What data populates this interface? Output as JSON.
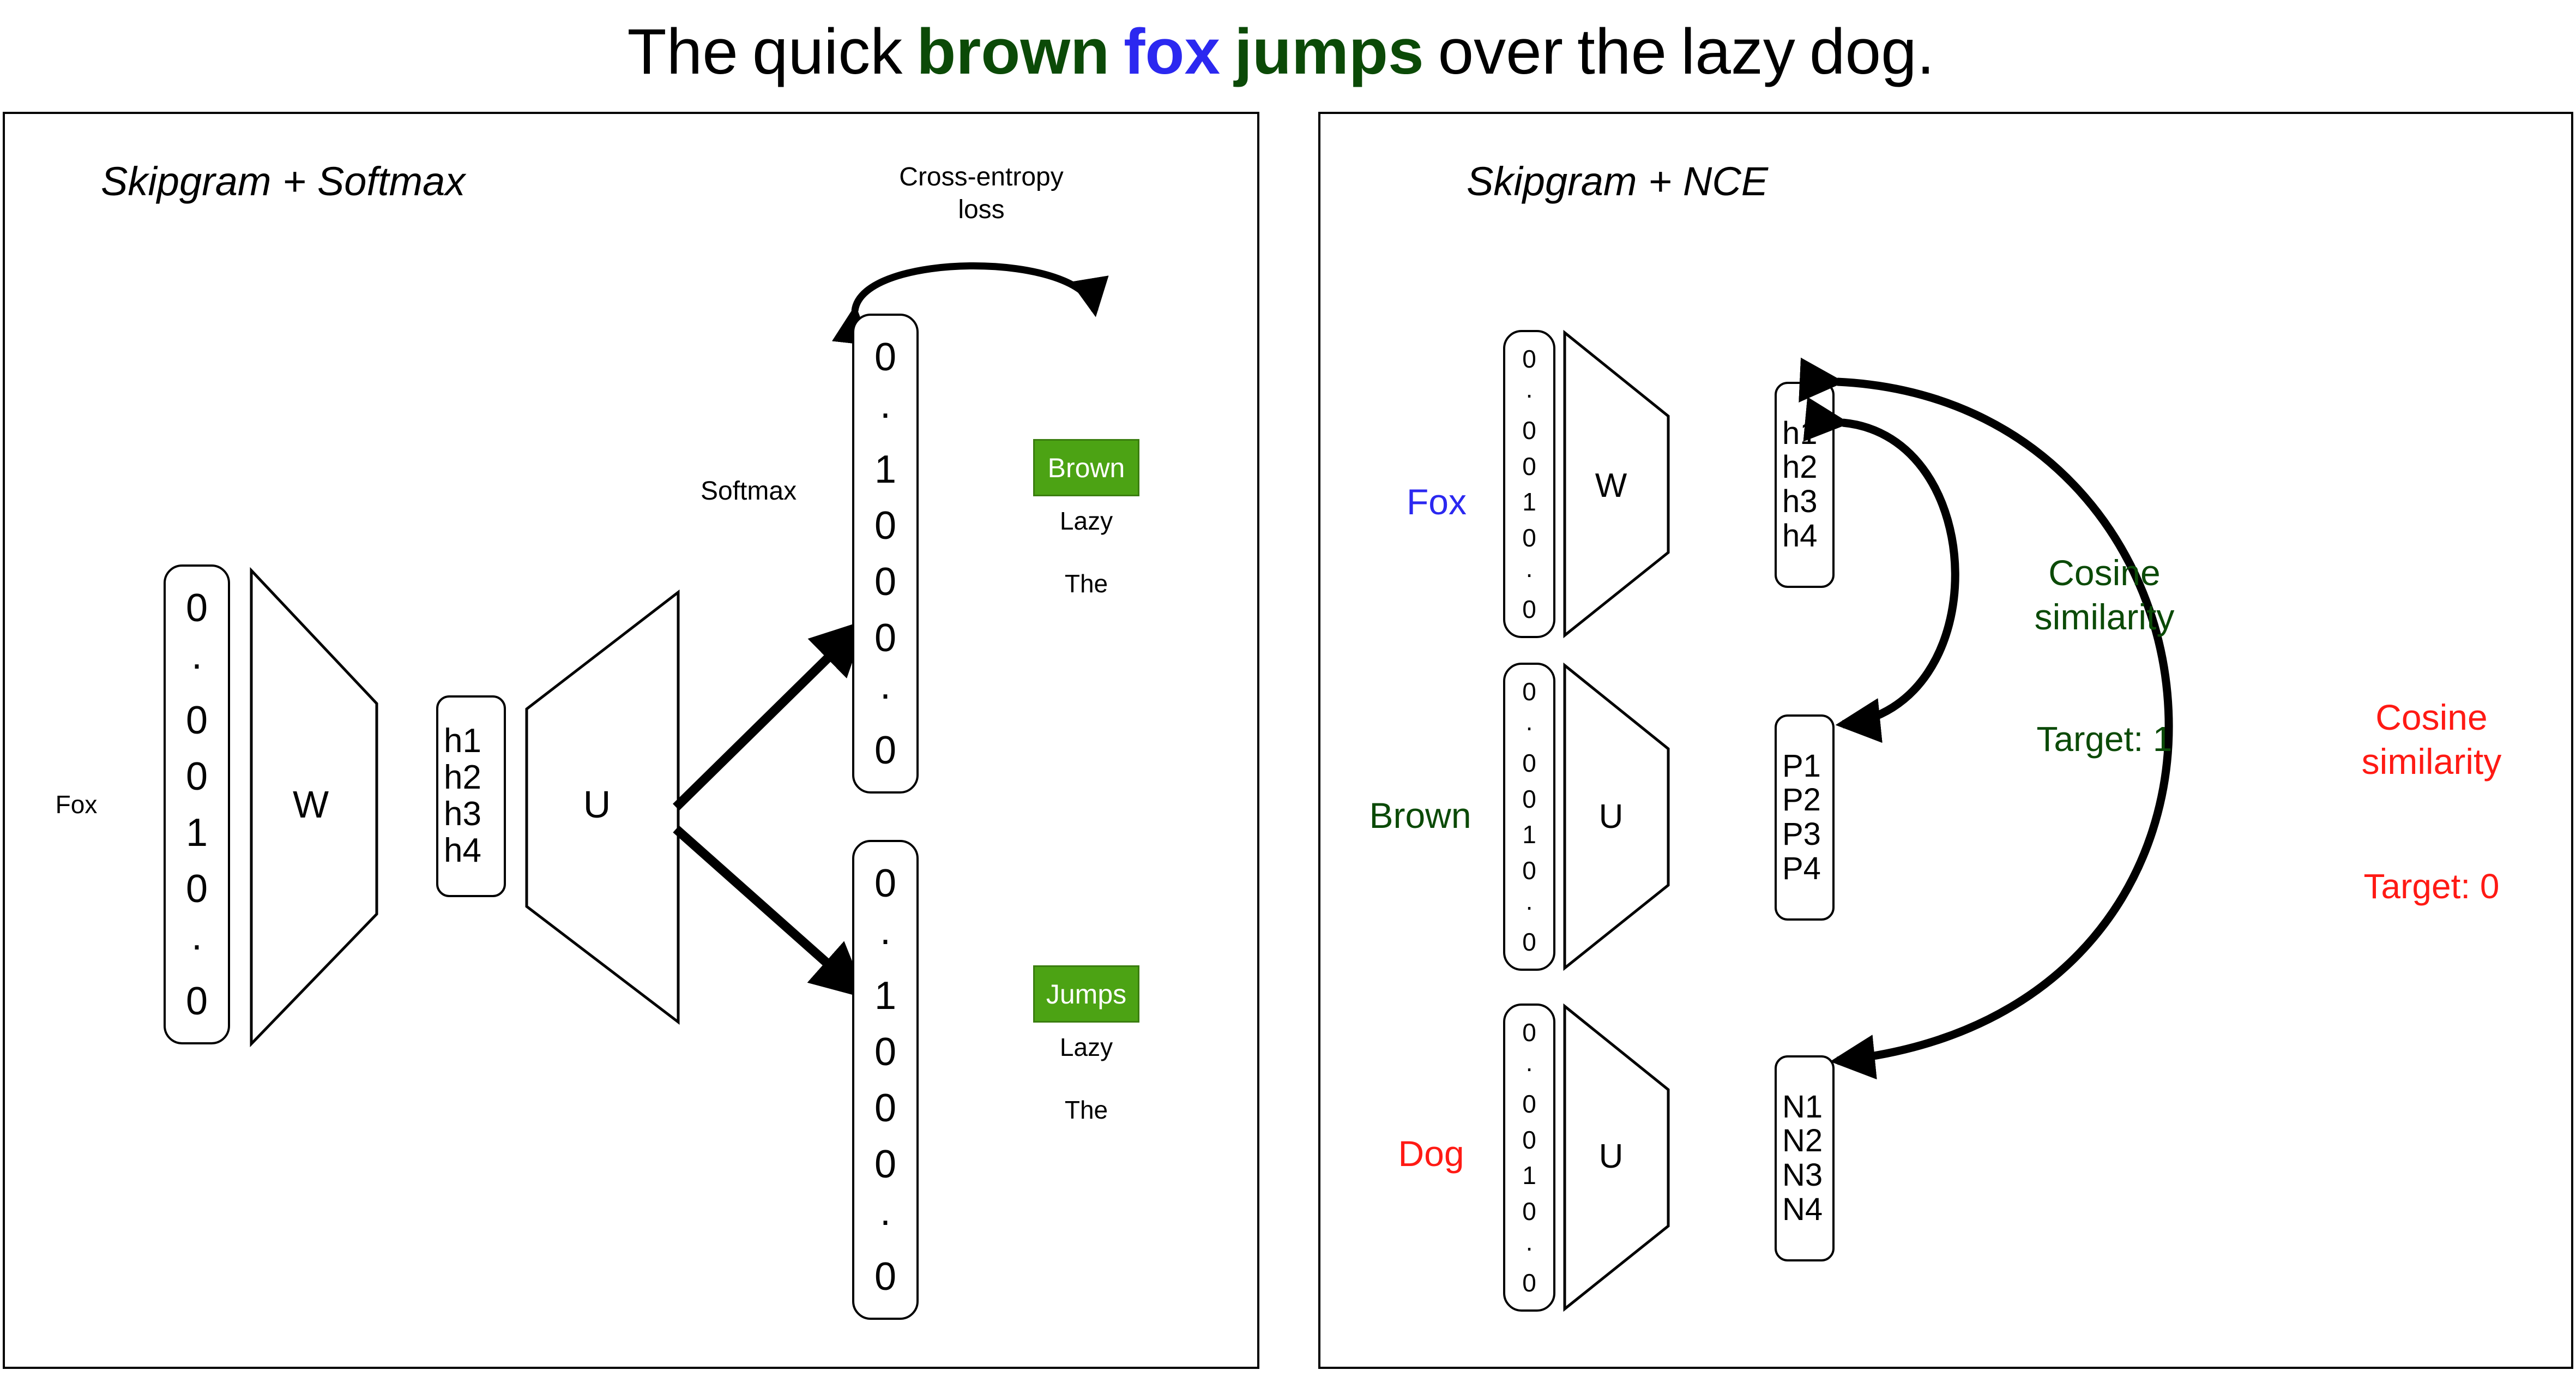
{
  "title": {
    "words": [
      {
        "text": "The",
        "style": "plain"
      },
      {
        "text": "quick",
        "style": "plain"
      },
      {
        "text": "brown",
        "style": "green"
      },
      {
        "text": "fox",
        "style": "blue"
      },
      {
        "text": "jumps",
        "style": "green"
      },
      {
        "text": "over",
        "style": "plain"
      },
      {
        "text": "the",
        "style": "plain"
      },
      {
        "text": "lazy",
        "style": "plain"
      },
      {
        "text": "dog.",
        "style": "plain"
      }
    ],
    "full_text": "The quick brown fox jumps over the lazy dog."
  },
  "colors": {
    "green_text": "#0b4a07",
    "blue_text": "#2b28f0",
    "red_text": "#ff1a14",
    "highlight_bg": "#4ca314",
    "highlight_border": "#3a7d0f",
    "highlight_fg": "#ffffff",
    "stroke": "#000000"
  },
  "left_panel": {
    "title": "Skipgram + Softmax",
    "input_label": "Fox",
    "input_vector": [
      "0",
      "·",
      "0",
      "0",
      "1",
      "0",
      "·",
      "0"
    ],
    "matrix_w": "W",
    "hidden": [
      "h1",
      "h2",
      "h3",
      "h4"
    ],
    "matrix_u": "U",
    "softmax_label": "Softmax",
    "loss_label_line1": "Cross-entropy",
    "loss_label_line2": "loss",
    "output_top": {
      "vector": [
        "0",
        "·",
        "1",
        "0",
        "0",
        "0",
        "·",
        "0"
      ],
      "words": [
        "Brown",
        "Lazy",
        "The"
      ],
      "highlighted_word": "Brown"
    },
    "output_bottom": {
      "vector": [
        "0",
        "·",
        "1",
        "0",
        "0",
        "0",
        "·",
        "0"
      ],
      "words": [
        "Jumps",
        "Lazy",
        "The"
      ],
      "highlighted_word": "Jumps"
    }
  },
  "right_panel": {
    "title": "Skipgram + NCE",
    "rows": [
      {
        "label": "Fox",
        "label_color": "blue",
        "vector": [
          "0",
          "·",
          "0",
          "0",
          "1",
          "0",
          "·",
          "0"
        ],
        "matrix": "W",
        "output": [
          "h1",
          "h2",
          "h3",
          "h4"
        ]
      },
      {
        "label": "Brown",
        "label_color": "green",
        "vector": [
          "0",
          "·",
          "0",
          "0",
          "1",
          "0",
          "·",
          "0"
        ],
        "matrix": "U",
        "output": [
          "P1",
          "P2",
          "P3",
          "P4"
        ]
      },
      {
        "label": "Dog",
        "label_color": "red",
        "vector": [
          "0",
          "·",
          "0",
          "0",
          "1",
          "0",
          "·",
          "0"
        ],
        "matrix": "U",
        "output": [
          "N1",
          "N2",
          "N3",
          "N4"
        ]
      }
    ],
    "positive_annotation": {
      "line1": "Cosine",
      "line2": "similarity",
      "target": "Target: 1"
    },
    "negative_annotation": {
      "line1": "Cosine",
      "line2": "similarity",
      "target": "Target: 0"
    }
  }
}
